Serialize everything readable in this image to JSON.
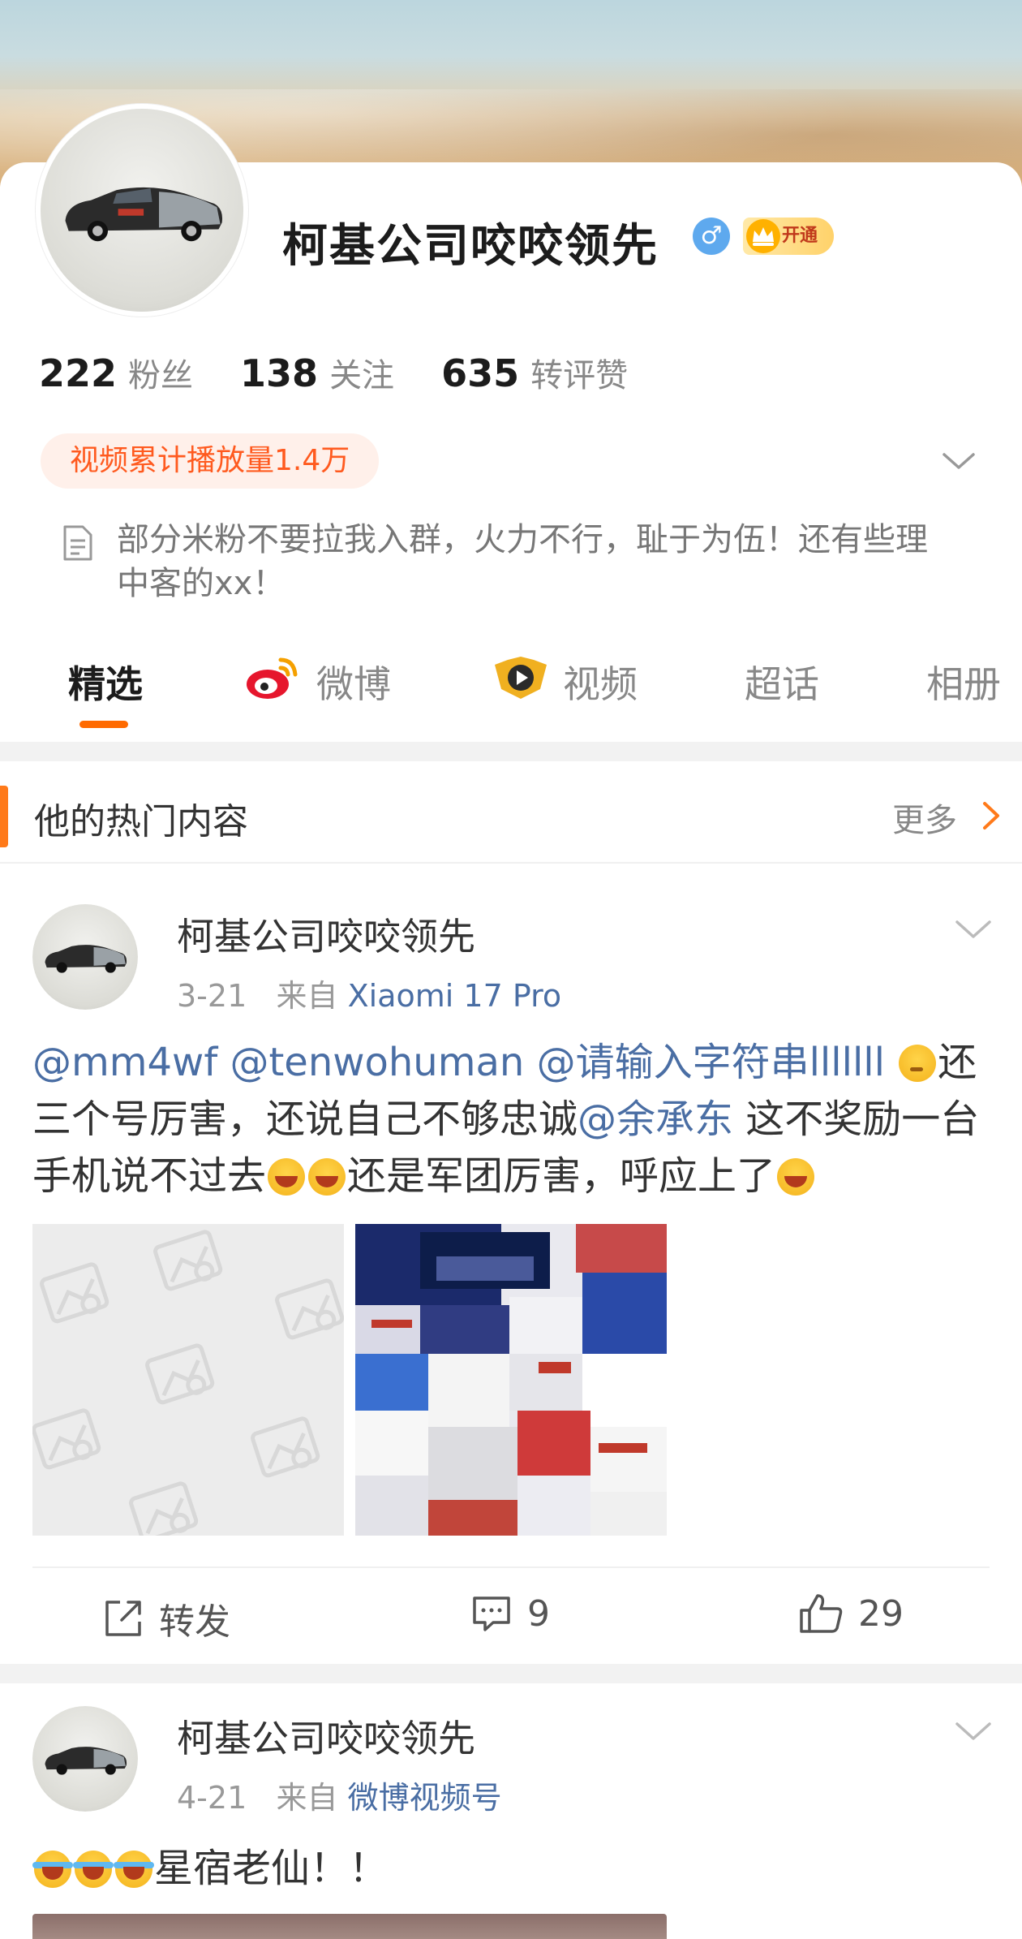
{
  "profile": {
    "username": "柯基公司咬咬领先",
    "gender_icon": "male-icon",
    "gender_symbol": "♂",
    "vip_label": "开通",
    "stats": [
      {
        "value": "222",
        "label": "粉丝"
      },
      {
        "value": "138",
        "label": "关注"
      },
      {
        "value": "635",
        "label": "转评赞"
      }
    ],
    "play_count": "视频累计播放量1.4万",
    "bio": "部分米粉不要拉我入群，火力不行，耻于为伍！还有些理中客的xx！"
  },
  "tabs": [
    {
      "label": "精选",
      "active": true
    },
    {
      "label": "微博",
      "icon": "weibo-icon"
    },
    {
      "label": "视频",
      "icon": "video-icon"
    },
    {
      "label": "超话"
    },
    {
      "label": "相册"
    }
  ],
  "hot_section": {
    "title": "他的热门内容",
    "more_label": "更多"
  },
  "posts": [
    {
      "author": "柯基公司咬咬领先",
      "date": "3-21",
      "from_label": "来自",
      "source": "Xiaomi 17 Pro",
      "text_segments": {
        "m1": "@mm4wf",
        "m2": "@tenwohuman",
        "m3": "@请输入字符串lllllll",
        "t1": "还三个号厉害，还说自己不够忠诚",
        "m4": "@余承东",
        "t2": " 这不奖励一台手机说不过去",
        "t3": "还是军团厉害，呼应上了"
      },
      "actions": {
        "repost_label": "转发",
        "comments": "9",
        "likes": "29"
      }
    },
    {
      "author": "柯基公司咬咬领先",
      "date": "4-21",
      "from_label": "来自",
      "source": "微博视频号",
      "text": "星宿老仙！！"
    }
  ],
  "colors": {
    "accent": "#ff6a00",
    "link": "#4a6ea4",
    "vip_gold": "#ffd26a"
  }
}
